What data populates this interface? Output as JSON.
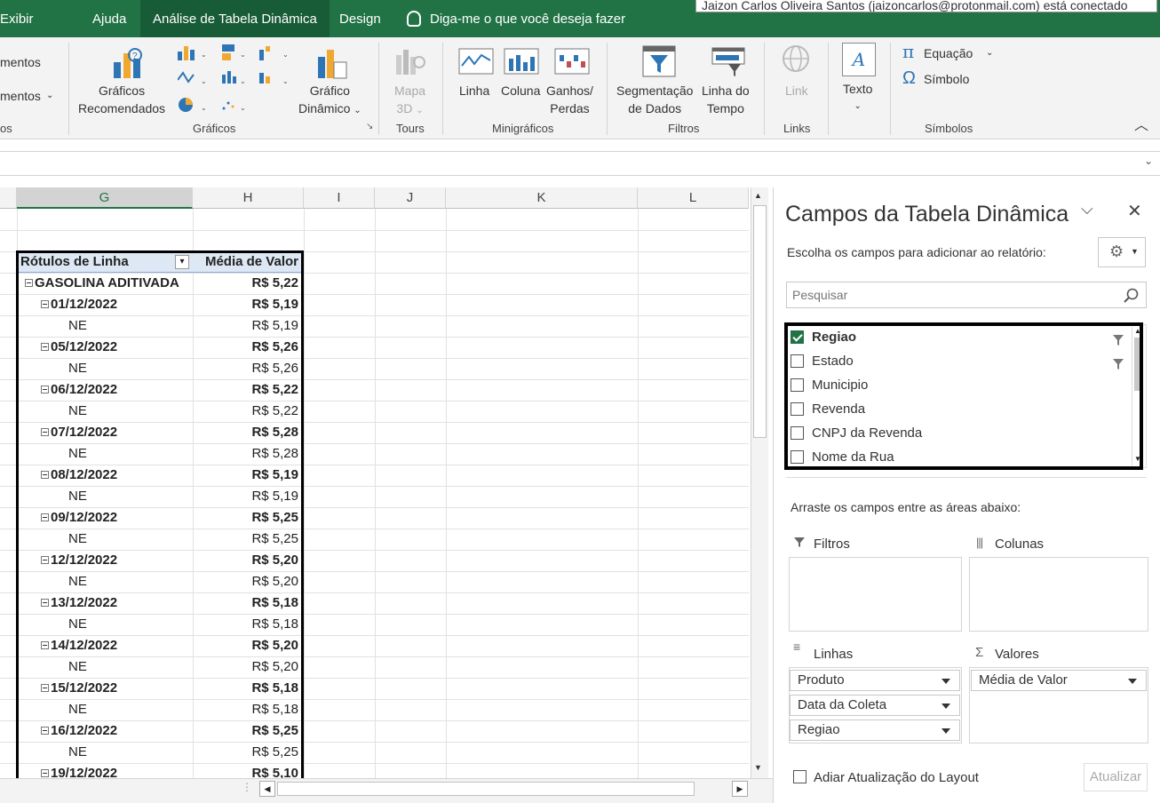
{
  "ribbon_tabs": [
    "Exibir",
    "Ajuda",
    "Análise de Tabela Dinâmica",
    "Design"
  ],
  "tell_me": "Diga-me o que você deseja fazer",
  "tooltip": "Jaizon Carlos Oliveira Santos (jaizoncarlos@protonmail.com) está conectado",
  "ribbon": {
    "left_partial": [
      "mentos",
      "mentos"
    ],
    "left_group": "os",
    "graficos_recomendados": [
      "Gráficos",
      "Recomendados"
    ],
    "grafico_dinamico": [
      "Gráfico",
      "Dinâmico"
    ],
    "graficos_group": "Gráficos",
    "mapa3d": [
      "Mapa",
      "3D"
    ],
    "tours_group": "Tours",
    "linha": "Linha",
    "coluna": "Coluna",
    "ganhos": [
      "Ganhos/",
      "Perdas"
    ],
    "minigraficos_group": "Minigráficos",
    "segmentacao": [
      "Segmentação",
      "de Dados"
    ],
    "linha_tempo": [
      "Linha do",
      "Tempo"
    ],
    "filtros_group": "Filtros",
    "link": "Link",
    "links_group": "Links",
    "texto": "Texto",
    "equacao": "Equação",
    "simbolo": "Símbolo",
    "simbolos_group": "Símbolos"
  },
  "columns": [
    "G",
    "H",
    "I",
    "J",
    "K",
    "L"
  ],
  "pivot": {
    "header_label": "Rótulos de Linha",
    "header_value": "Média de Valor",
    "rows": [
      {
        "label": "GASOLINA ADITIVADA",
        "value": "R$ 5,22",
        "level": 0
      },
      {
        "label": "01/12/2022",
        "value": "R$ 5,19",
        "level": 1
      },
      {
        "label": "NE",
        "value": "R$ 5,19",
        "level": 2
      },
      {
        "label": "05/12/2022",
        "value": "R$ 5,26",
        "level": 1
      },
      {
        "label": "NE",
        "value": "R$ 5,26",
        "level": 2
      },
      {
        "label": "06/12/2022",
        "value": "R$ 5,22",
        "level": 1
      },
      {
        "label": "NE",
        "value": "R$ 5,22",
        "level": 2
      },
      {
        "label": "07/12/2022",
        "value": "R$ 5,28",
        "level": 1
      },
      {
        "label": "NE",
        "value": "R$ 5,28",
        "level": 2
      },
      {
        "label": "08/12/2022",
        "value": "R$ 5,19",
        "level": 1
      },
      {
        "label": "NE",
        "value": "R$ 5,19",
        "level": 2
      },
      {
        "label": "09/12/2022",
        "value": "R$ 5,25",
        "level": 1
      },
      {
        "label": "NE",
        "value": "R$ 5,25",
        "level": 2
      },
      {
        "label": "12/12/2022",
        "value": "R$ 5,20",
        "level": 1
      },
      {
        "label": "NE",
        "value": "R$ 5,20",
        "level": 2
      },
      {
        "label": "13/12/2022",
        "value": "R$ 5,18",
        "level": 1
      },
      {
        "label": "NE",
        "value": "R$ 5,18",
        "level": 2
      },
      {
        "label": "14/12/2022",
        "value": "R$ 5,20",
        "level": 1
      },
      {
        "label": "NE",
        "value": "R$ 5,20",
        "level": 2
      },
      {
        "label": "15/12/2022",
        "value": "R$ 5,18",
        "level": 1
      },
      {
        "label": "NE",
        "value": "R$ 5,18",
        "level": 2
      },
      {
        "label": "16/12/2022",
        "value": "R$ 5,25",
        "level": 1
      },
      {
        "label": "NE",
        "value": "R$ 5,25",
        "level": 2
      },
      {
        "label": "19/12/2022",
        "value": "R$ 5,10",
        "level": 1
      }
    ]
  },
  "panel": {
    "title": "Campos da Tabela Dinâmica",
    "choose": "Escolha os campos para adicionar ao relatório:",
    "search_placeholder": "Pesquisar",
    "fields": [
      {
        "name": "Regiao",
        "checked": true,
        "filtered": true
      },
      {
        "name": "Estado",
        "checked": false,
        "filtered": true
      },
      {
        "name": "Municipio",
        "checked": false,
        "filtered": false
      },
      {
        "name": "Revenda",
        "checked": false,
        "filtered": false
      },
      {
        "name": "CNPJ da Revenda",
        "checked": false,
        "filtered": false
      },
      {
        "name": "Nome da Rua",
        "checked": false,
        "filtered": false
      }
    ],
    "drag": "Arraste os campos entre as áreas abaixo:",
    "filtros": "Filtros",
    "colunas": "Colunas",
    "linhas": "Linhas",
    "valores": "Valores",
    "linhas_items": [
      "Produto",
      "Data da Coleta",
      "Regiao"
    ],
    "valores_items": [
      "Média de Valor"
    ],
    "defer": "Adiar Atualização do Layout",
    "update": "Atualizar"
  }
}
